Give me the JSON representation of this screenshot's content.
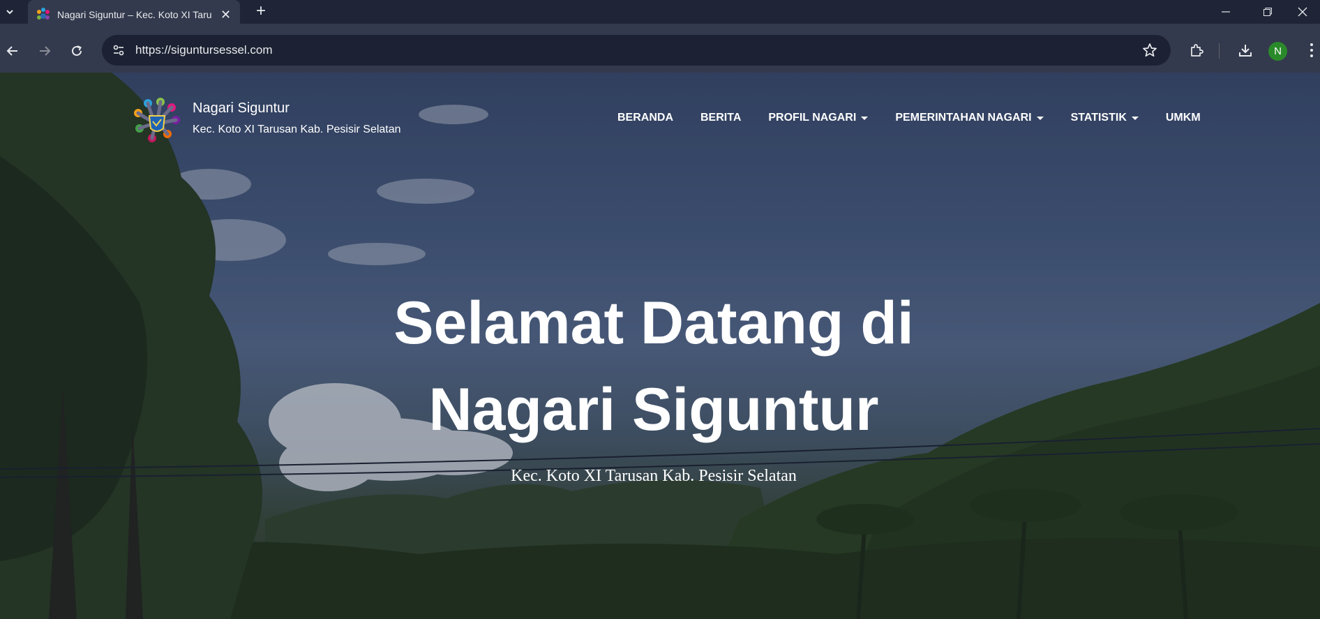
{
  "browser": {
    "tab_title": "Nagari Siguntur – Kec. Koto XI Tarusan Kab. Pesisir Selatan",
    "url": "https://siguntursessel.com",
    "profile_initial": "N"
  },
  "site": {
    "brand_name": "Nagari Siguntur",
    "brand_subtitle": "Kec. Koto XI Tarusan Kab. Pesisir Selatan",
    "nav": [
      {
        "label": "BERANDA"
      },
      {
        "label": "BERITA"
      },
      {
        "label": "PROFIL NAGARI"
      },
      {
        "label": "PEMERINTAHAN NAGARI"
      },
      {
        "label": "STATISTIK"
      },
      {
        "label": "UMKM"
      }
    ]
  },
  "hero": {
    "title_line1": "Selamat Datang di",
    "title_line2": "Nagari Siguntur",
    "subtitle": "Kec. Koto XI Tarusan Kab. Pesisir Selatan"
  },
  "colors": {
    "chrome_bg": "#1f2537",
    "toolbar_bg": "#343a4d",
    "avatar_bg": "#2a8a2a"
  }
}
